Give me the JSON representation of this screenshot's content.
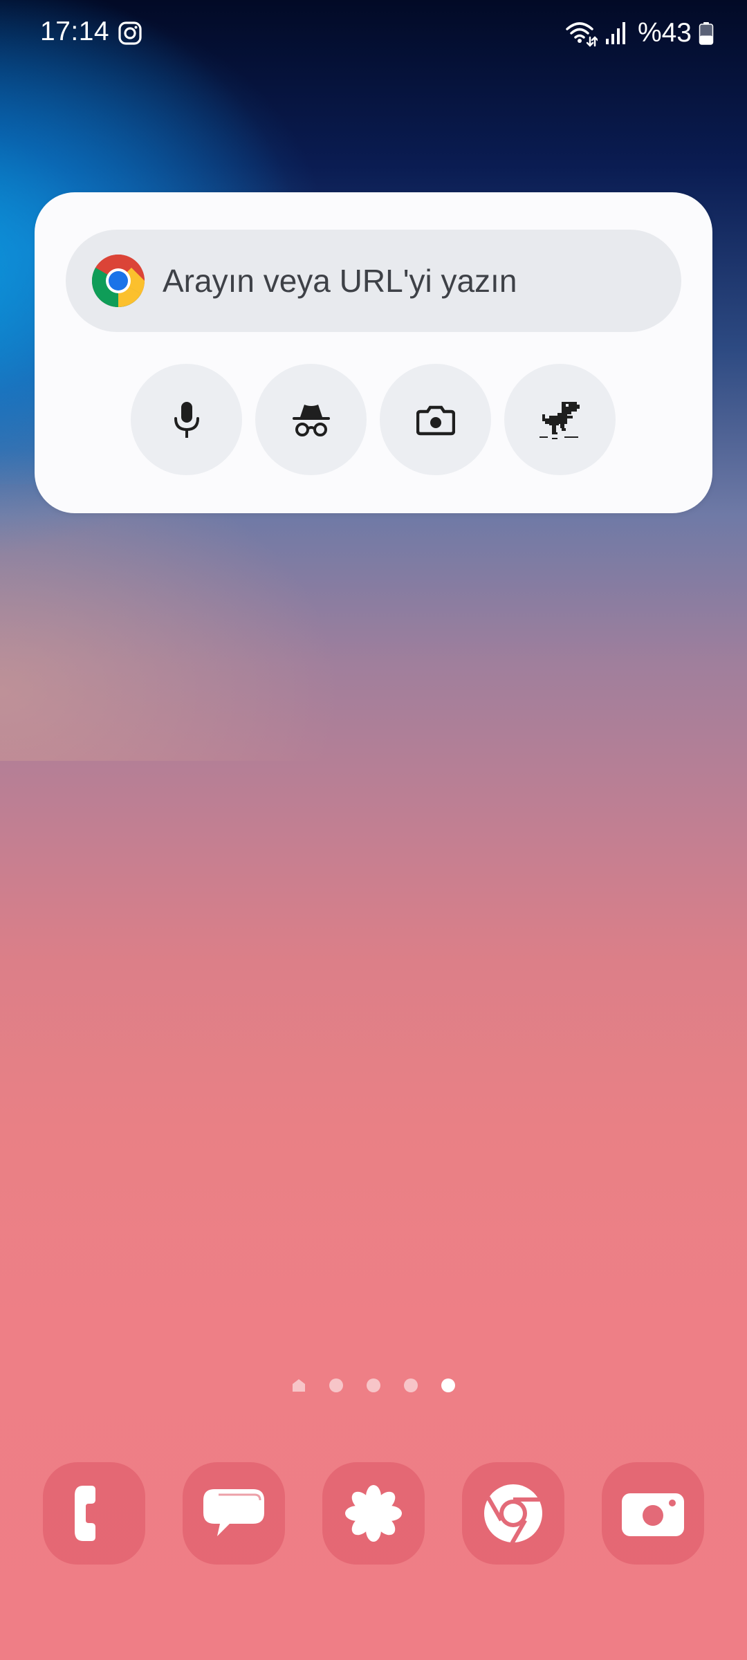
{
  "status_bar": {
    "time": "17:14",
    "notification_icons": [
      "instagram-icon"
    ],
    "system_icons": [
      "wifi-data-icon",
      "signal-icon"
    ],
    "battery_text": "%43",
    "battery_level": 0.43
  },
  "chrome_widget": {
    "search_placeholder": "Arayın veya URL'yi yazın",
    "shortcuts": [
      {
        "name": "voice-search",
        "icon": "microphone-icon"
      },
      {
        "name": "incognito",
        "icon": "incognito-icon"
      },
      {
        "name": "lens",
        "icon": "camera-icon"
      },
      {
        "name": "dino-game",
        "icon": "dinosaur-icon"
      }
    ]
  },
  "page_indicator": {
    "pages": 5,
    "home_page_index": 0,
    "current_page_index": 4
  },
  "dock": {
    "apps": [
      {
        "name": "phone",
        "icon": "phone-icon"
      },
      {
        "name": "messages",
        "icon": "message-icon"
      },
      {
        "name": "gallery",
        "icon": "flower-icon"
      },
      {
        "name": "chrome",
        "icon": "chrome-icon"
      },
      {
        "name": "camera",
        "icon": "camera-icon"
      }
    ]
  },
  "colors": {
    "widget_bg": "#fbfbfd",
    "search_pill_bg": "#e8eaee",
    "shortcut_bg": "#eceef2",
    "dock_icon_bg": "#e0606e",
    "icon_dark": "#1f1f1f"
  }
}
